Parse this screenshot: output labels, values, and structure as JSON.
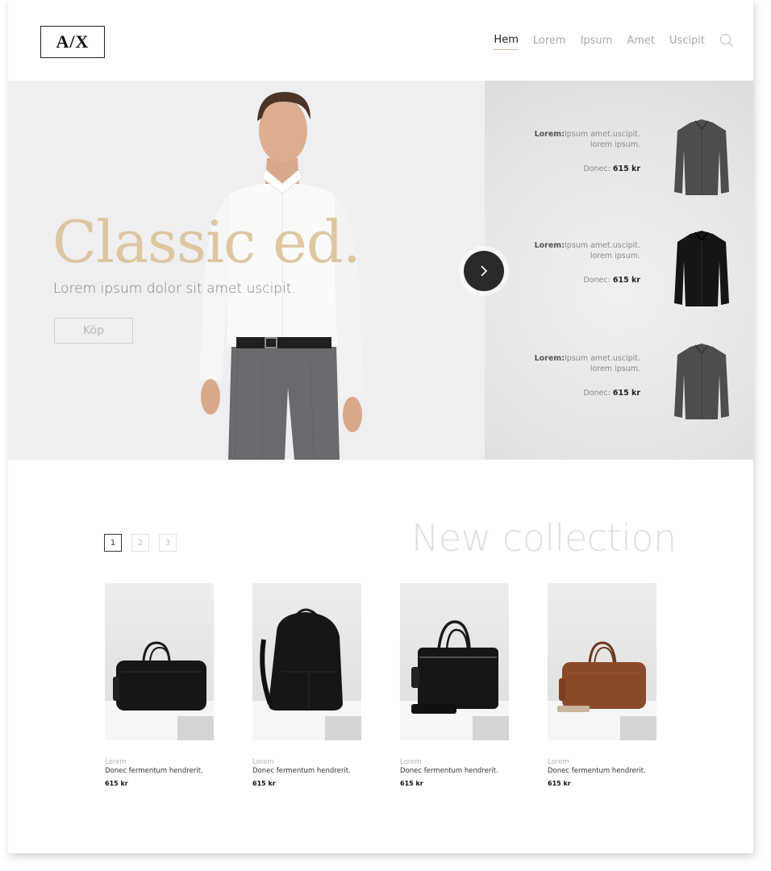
{
  "header": {
    "logo": "A/X",
    "nav": [
      "Hem",
      "Lorem",
      "Ipsum",
      "Amet",
      "Uscipit"
    ],
    "active_nav": "Hem",
    "search_icon": "search-icon"
  },
  "hero": {
    "title": "Classic ed.",
    "subtitle": "Lorem ipsum dolor sit amet uscipit.",
    "button": "Köp",
    "next_icon": "chevron-right-icon",
    "products": [
      {
        "label": "Lorem:",
        "line1": "Ipsum amet.uscipit.",
        "line2": "lorem ipsum.",
        "price_label": "Donec:",
        "price": "615 kr",
        "color": "#4d4d4f"
      },
      {
        "label": "Lorem:",
        "line1": "Ipsum amet.uscipit.",
        "line2": "lorem ipsum.",
        "price_label": "Donec:",
        "price": "615 kr",
        "color": "#151515"
      },
      {
        "label": "Lorem:",
        "line1": "Ipsum amet.uscipit.",
        "line2": "lorem ipsum.",
        "price_label": "Donec:",
        "price": "615 kr",
        "color": "#4d4d4f"
      }
    ]
  },
  "collection": {
    "title": "New collection",
    "pages": [
      "1",
      "2",
      "3"
    ],
    "active_page": "1",
    "items": [
      {
        "category": "Lorem",
        "description": "Donec fermentum hendrerit.",
        "price": "615 kr",
        "product": "black-duffel-bag"
      },
      {
        "category": "Lorem",
        "description": "Donec fermentum hendrerit.",
        "price": "615 kr",
        "product": "black-backpack"
      },
      {
        "category": "Lorem",
        "description": "Donec fermentum hendrerit.",
        "price": "615 kr",
        "product": "black-briefcase"
      },
      {
        "category": "Lorem",
        "description": "Donec fermentum hendrerit.",
        "price": "615 kr",
        "product": "brown-duffel-bag"
      }
    ]
  },
  "colors": {
    "accent_gold": "#dcc39a",
    "dark_button": "#2a2a2a",
    "leather_brown": "#8a4a2a"
  }
}
